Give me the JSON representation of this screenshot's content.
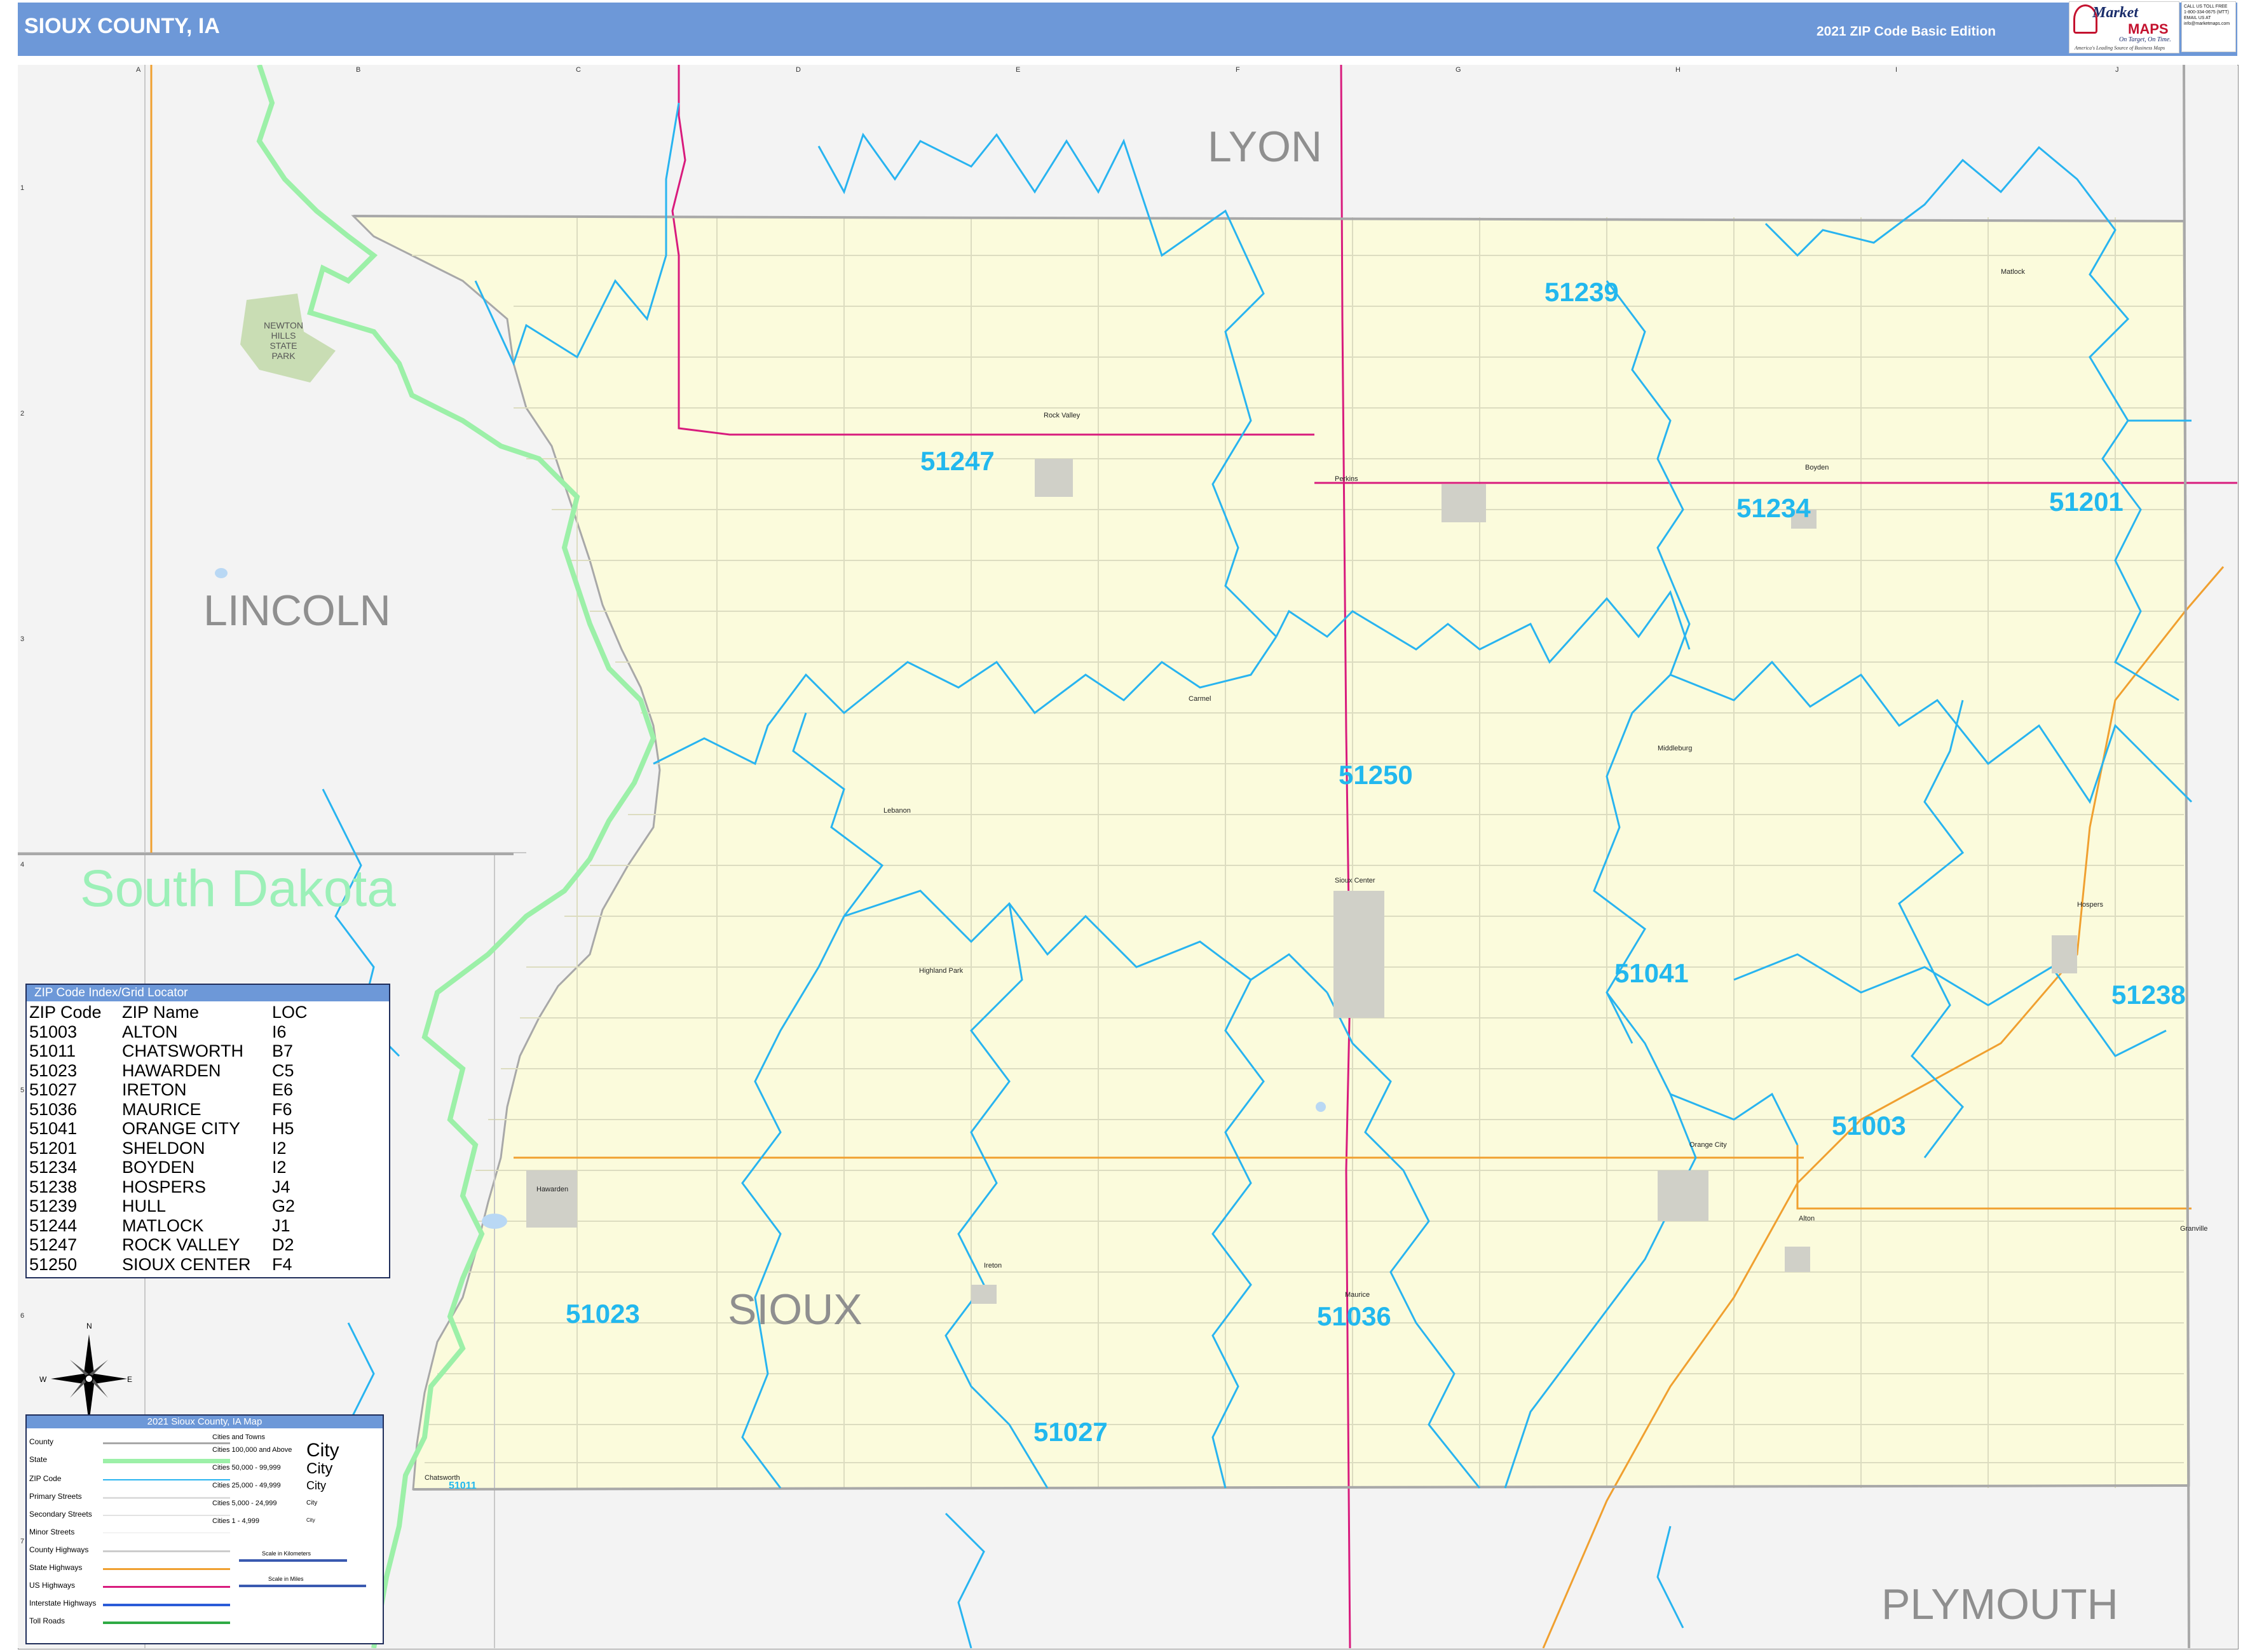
{
  "header": {
    "title": "SIOUX COUNTY, IA",
    "edition": "2021 ZIP Code Basic Edition",
    "logo": {
      "line1": "Market",
      "line2": "MAPS",
      "tagline": "On Target, On Time.",
      "subtag": "America's Leading Source of Business Maps"
    },
    "contact": [
      "CALL US TOLL FREE",
      "1-800-334-0675 (MTT)",
      "EMAIL US AT",
      "info@marketmaps.com"
    ]
  },
  "grid": {
    "columns": [
      "A",
      "B",
      "C",
      "D",
      "E",
      "F",
      "G",
      "H",
      "I",
      "J"
    ],
    "rows": [
      "1",
      "2",
      "3",
      "4",
      "5",
      "6",
      "7"
    ]
  },
  "regions": {
    "lyon": "LYON",
    "lincoln": "LINCOLN",
    "south_dakota": "South Dakota",
    "sioux": "SIOUX",
    "plymouth": "PLYMOUTH"
  },
  "zip_labels": {
    "z51239": "51239",
    "z51247": "51247",
    "z51234": "51234",
    "z51201": "51201",
    "z51250": "51250",
    "z51041": "51041",
    "z51238": "51238",
    "z51003": "51003",
    "z51023": "51023",
    "z51036": "51036",
    "z51027": "51027",
    "z51011": "51011"
  },
  "places": {
    "rock_valley": "Rock Valley",
    "perkins": "Perkins",
    "boyden": "Boyden",
    "matlock": "Matlock",
    "carmel": "Carmel",
    "middleburg": "Middleburg",
    "sioux_center": "Sioux Center",
    "hospers": "Hospers",
    "lebanon": "Lebanon",
    "highland_park": "Highland Park",
    "orange_city": "Orange City",
    "alton": "Alton",
    "granville": "Granville",
    "hawarden": "Hawarden",
    "ireton": "Ireton",
    "maurice": "Maurice",
    "chatsworth": "Chatsworth",
    "newton_hills": "NEWTON HILLS STATE PARK"
  },
  "compass": {
    "n": "N",
    "s": "S",
    "e": "E",
    "w": "W"
  },
  "zip_index": {
    "title": "ZIP Code Index/Grid Locator",
    "headers": [
      "ZIP Code",
      "ZIP Name",
      "LOC"
    ],
    "rows": [
      [
        "51003",
        "ALTON",
        "I6"
      ],
      [
        "51011",
        "CHATSWORTH",
        "B7"
      ],
      [
        "51023",
        "HAWARDEN",
        "C5"
      ],
      [
        "51027",
        "IRETON",
        "E6"
      ],
      [
        "51036",
        "MAURICE",
        "F6"
      ],
      [
        "51041",
        "ORANGE CITY",
        "H5"
      ],
      [
        "51201",
        "SHELDON",
        "I2"
      ],
      [
        "51234",
        "BOYDEN",
        "I2"
      ],
      [
        "51238",
        "HOSPERS",
        "J4"
      ],
      [
        "51239",
        "HULL",
        "G2"
      ],
      [
        "51244",
        "MATLOCK",
        "J1"
      ],
      [
        "51247",
        "ROCK VALLEY",
        "D2"
      ],
      [
        "51250",
        "SIOUX CENTER",
        "F4"
      ]
    ]
  },
  "legend": {
    "title": "2021 Sioux County, IA Map",
    "items": [
      "County",
      "State",
      "ZIP Code",
      "Primary Streets",
      "Secondary Streets",
      "Minor Streets",
      "County Highways",
      "State Highways",
      "US Highways",
      "Interstate Highways",
      "Toll Roads"
    ],
    "cities_heading": "Cities and Towns",
    "city_classes": [
      "Cities 100,000 and Above",
      "Cities 50,000 - 99,999",
      "Cities 25,000 - 49,999",
      "Cities 5,000 - 24,999",
      "Cities 1 - 4,999"
    ],
    "city_sample": "City",
    "scale_km": "Scale in Kilometers",
    "scale_mi": "Scale in Miles"
  },
  "colors": {
    "header": "#6d98d8",
    "county_fill": "#fbfbdc",
    "outside_fill": "#f3f3f3",
    "zip_line": "#28b4f0",
    "zip_label": "#22b8ee",
    "state_line": "#9cf0a8",
    "us_highway": "#d81b7d",
    "state_highway": "#f0a030",
    "region_label": "#8f8f8f"
  }
}
